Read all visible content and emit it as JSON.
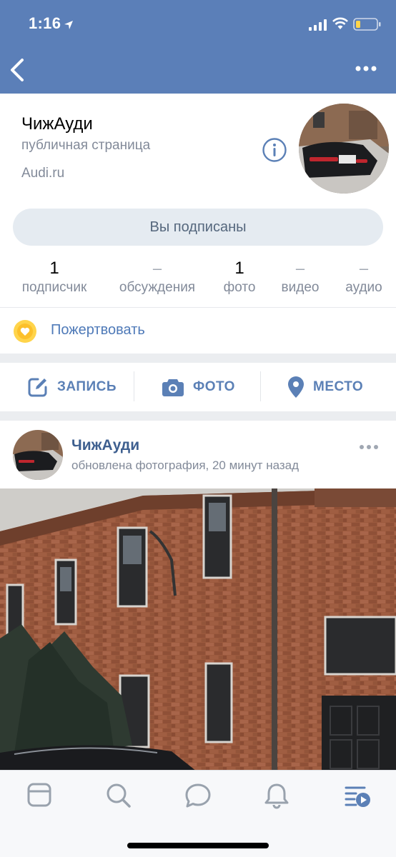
{
  "status": {
    "time": "1:16"
  },
  "profile": {
    "name": "ЧижАуди",
    "type": "публичная страница",
    "site": "Audi.ru",
    "subscribe_label": "Вы подписаны",
    "counters": [
      {
        "value": "1",
        "label": "подписчик"
      },
      {
        "value": "–",
        "label": "обсуждения"
      },
      {
        "value": "1",
        "label": "фото"
      },
      {
        "value": "–",
        "label": "видео"
      },
      {
        "value": "–",
        "label": "аудио"
      }
    ],
    "donate_label": "Пожертвовать"
  },
  "actions": {
    "post_label": "ЗАПИСЬ",
    "photo_label": "ФОТО",
    "place_label": "МЕСТО"
  },
  "post": {
    "author": "ЧижАуди",
    "meta": "обновлена фотография, 20 минут назад"
  },
  "colors": {
    "header": "#5b7fb8",
    "accent": "#5b80b6",
    "secondary_text": "#828a99",
    "donate_yellow": "#ffd44a"
  },
  "icons": {
    "back": "chevron-left-icon",
    "more": "more-horizontal-icon",
    "info": "info-icon",
    "donate": "heart-icon",
    "post": "edit-icon",
    "photo": "camera-icon",
    "place": "location-pin-icon",
    "tabs": [
      "news-icon",
      "search-icon",
      "messages-icon",
      "notifications-icon",
      "feed-video-icon"
    ]
  }
}
